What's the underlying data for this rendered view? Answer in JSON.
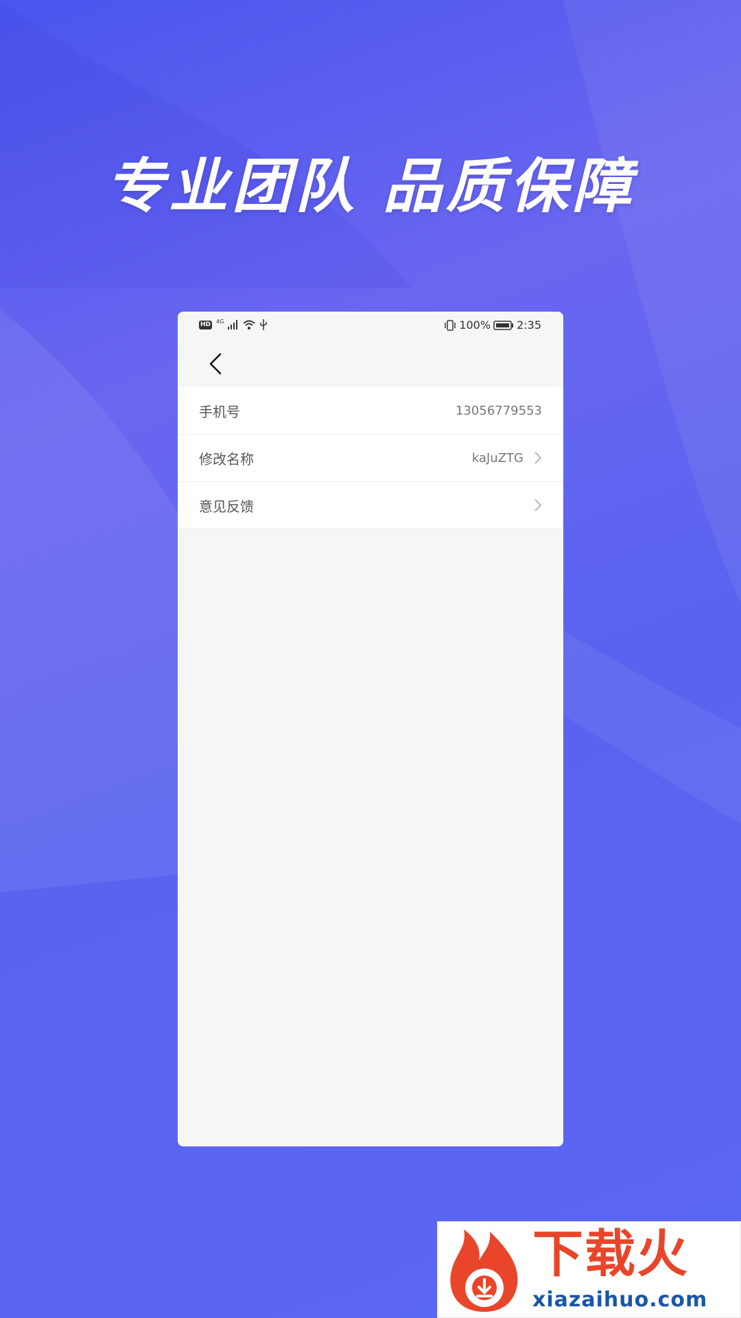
{
  "promo": {
    "headline": "专业团队 品质保障"
  },
  "status_bar": {
    "hd": "HD",
    "network": "4G",
    "battery_percent": "100%",
    "time": "2:35",
    "icons": [
      "hd-icon",
      "signal-icon",
      "wifi-icon",
      "usb-icon",
      "vibrate-icon",
      "battery-icon"
    ]
  },
  "nav": {
    "back_icon": "back-arrow-icon"
  },
  "settings": {
    "items": [
      {
        "label": "手机号",
        "value": "13056779553",
        "has_arrow": false
      },
      {
        "label": "修改名称",
        "value": "kaJuZTG",
        "has_arrow": true
      },
      {
        "label": "意见反馈",
        "value": "",
        "has_arrow": true
      }
    ]
  },
  "watermark": {
    "brand_cn": "下载火",
    "brand_url": "xiazaihuo.com"
  },
  "colors": {
    "background": "#5b66f2",
    "phone_bg": "#f6f6f6",
    "row_bg": "#ffffff",
    "brand_red": "#e8452a",
    "brand_blue": "#1a56a6"
  }
}
